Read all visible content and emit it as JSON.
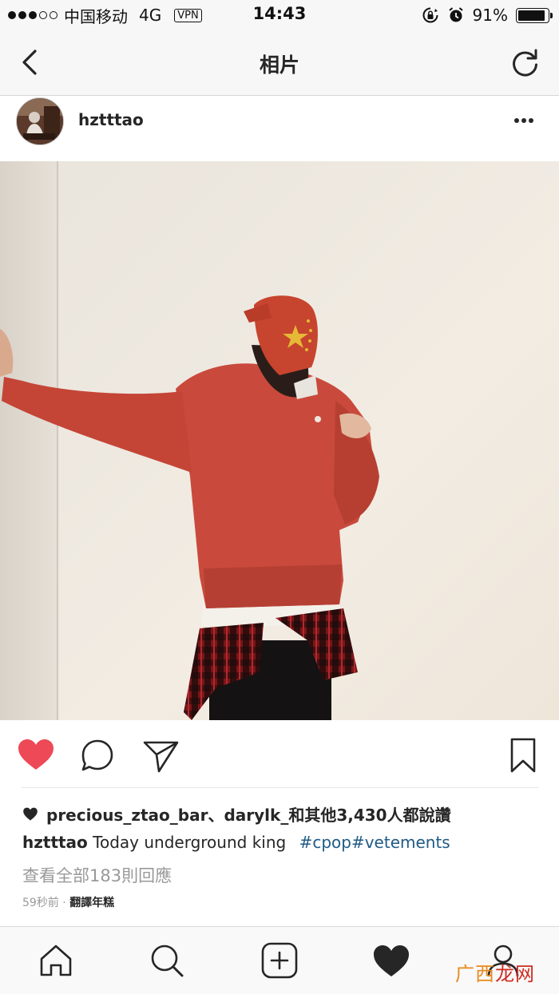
{
  "status_bar": {
    "carrier": "中国移动",
    "network": "4G",
    "vpn": "VPN",
    "time": "14:43",
    "battery_level": "91%",
    "battery_fraction": 0.91,
    "signal_bars": 3,
    "icons": [
      "orientation-lock-icon",
      "alarm-icon",
      "battery-icon"
    ]
  },
  "nav": {
    "title": "相片",
    "back_icon": "chevron-left-icon",
    "refresh_icon": "refresh-icon"
  },
  "post": {
    "username": "hztttao",
    "more_icon": "more-horizontal-icon",
    "liked": true,
    "likes_text": "precious_ztao_bar、darylk_和其他3,430人都說讚",
    "caption_user": "hztttao",
    "caption_text": "Today underground king",
    "caption_tags": "#cpop#vetements",
    "view_comments": "查看全部183則回應",
    "time_ago": "59秒前",
    "separator": "·",
    "translate": "翻譯年糕"
  },
  "actions": {
    "like_icon": "heart-filled-icon",
    "comment_icon": "comment-icon",
    "share_icon": "direct-share-icon",
    "save_icon": "bookmark-icon"
  },
  "tab_bar": {
    "tabs": [
      "home-icon",
      "search-icon",
      "add-post-icon",
      "activity-heart-icon",
      "profile-icon"
    ]
  },
  "watermark": {
    "part1": "广西",
    "part2": "龙网"
  },
  "colors": {
    "heart": "#ed4956",
    "hashtag": "#1f5a85",
    "secondary_text": "#999999",
    "watermark_orange": "#e8891e",
    "watermark_red": "#cf2b21"
  }
}
